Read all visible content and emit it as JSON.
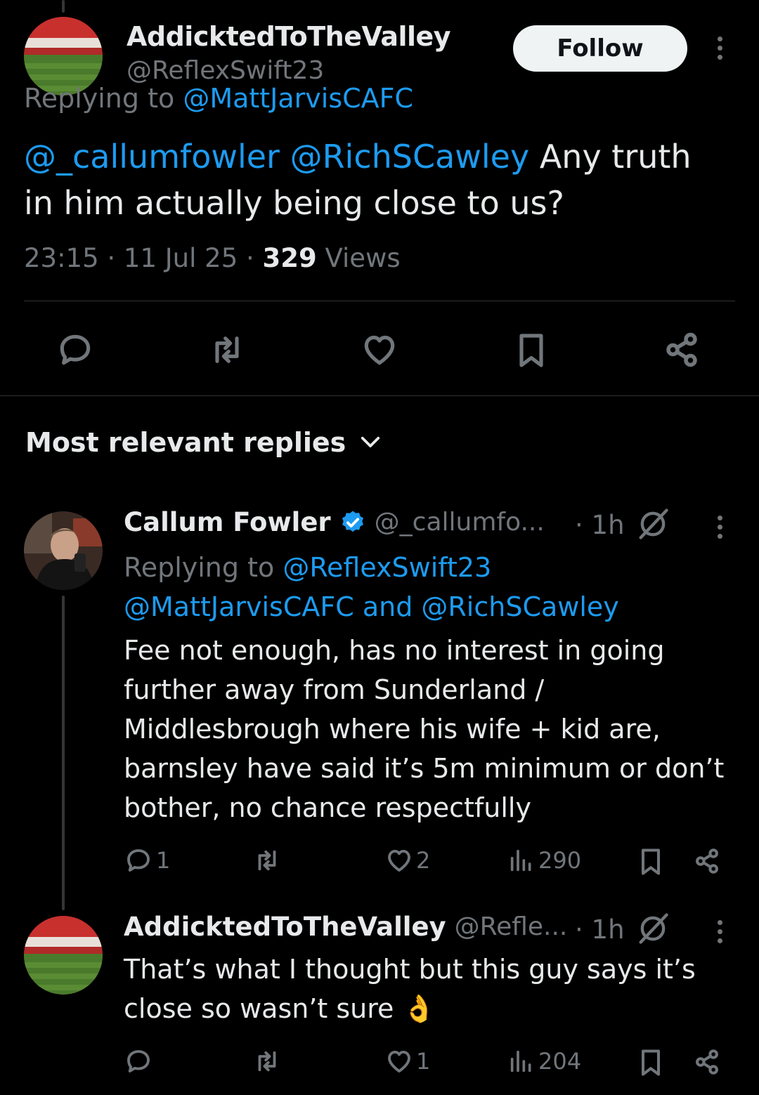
{
  "main_tweet": {
    "display_name": "AddicktedToTheValley",
    "handle": "@ReflexSwift23",
    "follow_label": "Follow",
    "replying_prefix": "Replying to ",
    "replying_to": "@MattJarvisCAFC",
    "mentions": "@_callumfowler @RichSCawley",
    "text_line1": " Any truth",
    "text_line2": "in him actually being close to us?",
    "time": "23:15 · 11 Jul 25 · ",
    "views_count": "329",
    "views_label": " Views"
  },
  "actions": [
    "reply-icon",
    "retweet-icon",
    "like-icon",
    "bookmark-icon",
    "share-icon"
  ],
  "replies_header": {
    "label": "Most relevant replies"
  },
  "replies": [
    {
      "display_name": "Callum Fowler",
      "verified": true,
      "handle": "@_callumfo...",
      "age": "· 1h",
      "replying_prefix": "Replying to ",
      "replying_to_line1": "@ReflexSwift23",
      "replying_to_line2a": "@MattJarvisCAFC",
      "replying_and": " and ",
      "replying_to_line2b": "@RichSCawley",
      "text_lines": [
        "Fee not enough, has no interest in going",
        "further away from Sunderland /",
        "Middlesbrough where his wife + kid are,",
        "barnsley have said it’s 5m minimum or don’t",
        "bother, no chance respectfully"
      ],
      "reply_count": "1",
      "retweet_count": "",
      "like_count": "2",
      "view_count": "290"
    },
    {
      "display_name": "AddicktedToTheValley",
      "handle": "@Refle...",
      "age": "· 1h",
      "text_lines": [
        "That’s what I thought but this guy says it’s",
        "close so wasn’t sure 👌"
      ],
      "reply_count": "",
      "retweet_count": "",
      "like_count": "1",
      "view_count": "204"
    }
  ],
  "colors": {
    "background": "#000000",
    "text": "#e7e9ea",
    "secondary": "#71767b",
    "link": "#1d9bf0",
    "verified": "#1d9bf0"
  }
}
